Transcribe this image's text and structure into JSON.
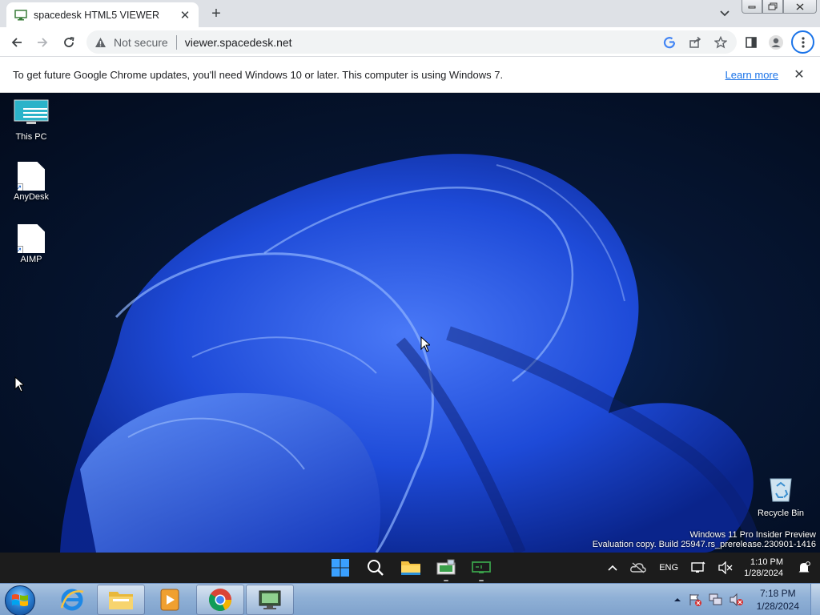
{
  "browser": {
    "tab": {
      "title": "spacedesk HTML5 VIEWER"
    },
    "new_tab": "+",
    "window_controls": {
      "minimize": "▭",
      "maximize": "❐",
      "close": "✕"
    },
    "omnibox": {
      "security_label": "Not secure",
      "url": "viewer.spacedesk.net"
    },
    "infobar": {
      "message": "To get future Google Chrome updates, you'll need Windows 10 or later. This computer is using Windows 7.",
      "link": "Learn more"
    },
    "accent": "#1a73e8"
  },
  "remote_desktop": {
    "icons": [
      {
        "label": "This PC",
        "icon": "monitor-icon"
      },
      {
        "label": "AnyDesk",
        "icon": "file-shortcut-icon"
      },
      {
        "label": "AIMP",
        "icon": "file-shortcut-icon"
      }
    ],
    "recycle_bin": {
      "label": "Recycle Bin"
    },
    "watermark": {
      "line1": "Windows 11 Pro Insider Preview",
      "line2": "Evaluation copy. Build 25947.rs_prerelease.230901-1416"
    },
    "taskbar": {
      "pinned": [
        "windows-start-icon",
        "search-icon",
        "file-explorer-icon",
        "app-icon",
        "spacedesk-icon"
      ],
      "tray": {
        "language": "ENG",
        "time": "1:10 PM",
        "date": "1/28/2024"
      }
    }
  },
  "host_taskbar": {
    "items": [
      "windows-orb-icon",
      "internet-explorer-icon",
      "windows-explorer-icon",
      "media-player-icon",
      "chrome-icon",
      "remote-app-icon"
    ],
    "active_item": "chrome-icon",
    "tray": {
      "time": "7:18 PM",
      "date": "1/28/2024"
    }
  }
}
